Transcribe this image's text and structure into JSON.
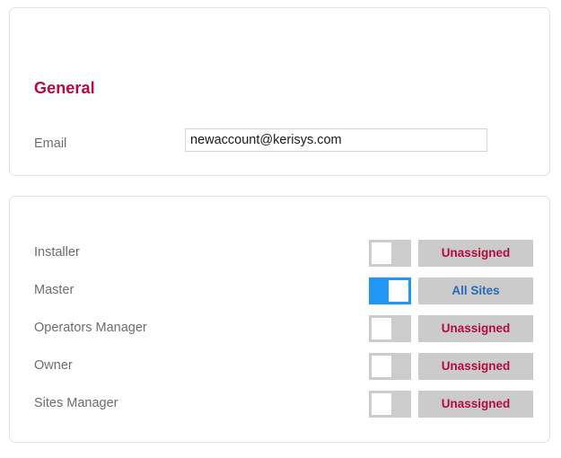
{
  "general": {
    "title": "General",
    "email": {
      "label": "Email",
      "value": "newaccount@kerisys.com",
      "placeholder": ""
    }
  },
  "roles": {
    "items": [
      {
        "label": "Installer",
        "enabled": false,
        "status": "Unassigned",
        "status_state": "unassigned"
      },
      {
        "label": "Master",
        "enabled": true,
        "status": "All Sites",
        "status_state": "assigned"
      },
      {
        "label": "Operators Manager",
        "enabled": false,
        "status": "Unassigned",
        "status_state": "unassigned"
      },
      {
        "label": "Owner",
        "enabled": false,
        "status": "Unassigned",
        "status_state": "unassigned"
      },
      {
        "label": "Sites Manager",
        "enabled": false,
        "status": "Unassigned",
        "status_state": "unassigned"
      }
    ]
  },
  "colors": {
    "accent_crimson": "#b50b3e",
    "toggle_on": "#2196f3",
    "toggle_off_track": "#cccccc",
    "status_button_bg": "#cbcbcb",
    "assigned_text": "#2a69b8",
    "label_text": "#6d6d6d",
    "card_border": "#e3e3e3"
  }
}
